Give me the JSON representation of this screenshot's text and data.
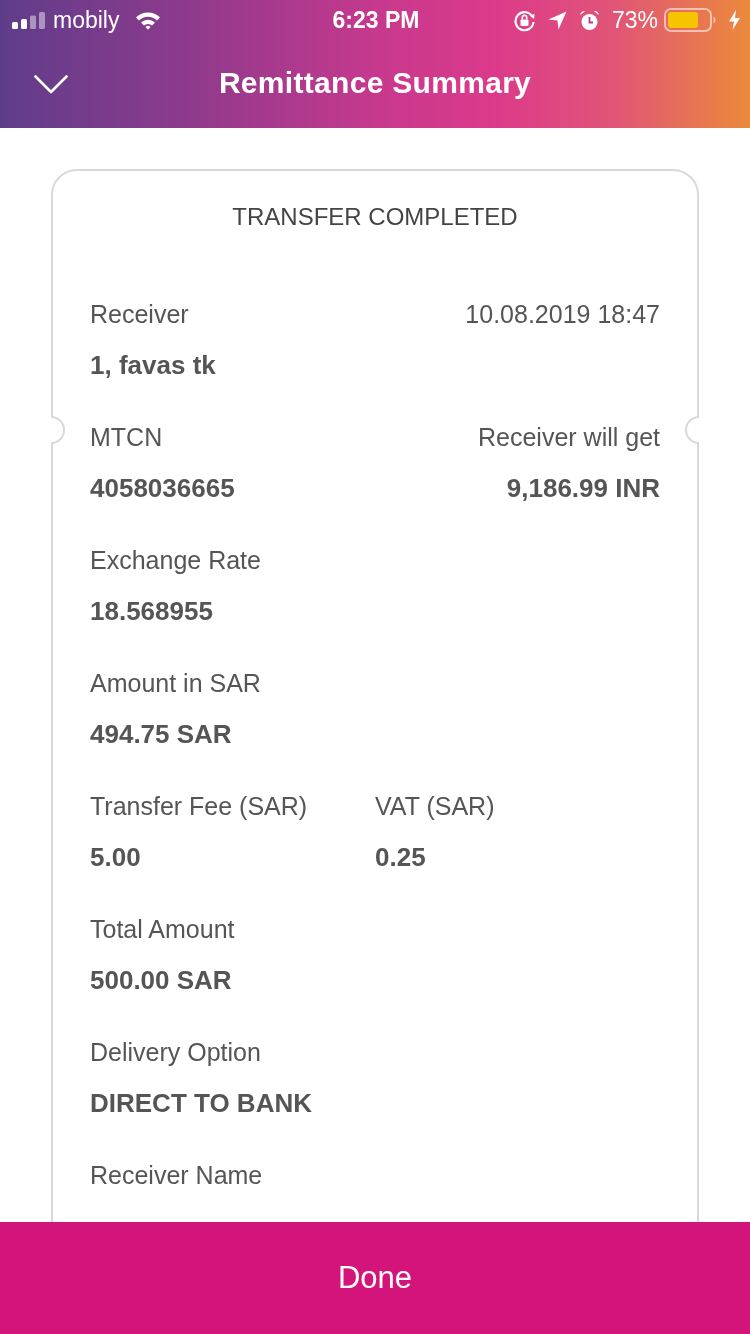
{
  "status_bar": {
    "carrier": "mobily",
    "time": "6:23 PM",
    "battery": "73%"
  },
  "header": {
    "title": "Remittance Summary"
  },
  "receipt": {
    "title": "TRANSFER COMPLETED",
    "rows": [
      {
        "kind": "split",
        "fields": [
          {
            "label": "Receiver",
            "value": "1, favas tk"
          },
          {
            "date": "10.08.2019 18:47"
          }
        ]
      },
      {
        "kind": "split",
        "fields": [
          {
            "label": "MTCN",
            "value": "4058036665"
          },
          {
            "label": "Receiver will get",
            "value": "9,186.99 INR"
          }
        ]
      },
      {
        "kind": "columns",
        "fields": [
          {
            "label": "Exchange Rate",
            "value": "18.568955"
          }
        ]
      },
      {
        "kind": "columns",
        "fields": [
          {
            "label": "Amount in SAR",
            "value": "494.75 SAR"
          }
        ]
      },
      {
        "kind": "columns",
        "fields": [
          {
            "label": "Transfer Fee (SAR)",
            "value": "5.00"
          },
          {
            "label": "VAT (SAR)",
            "value": "0.25"
          }
        ]
      },
      {
        "kind": "columns",
        "fields": [
          {
            "label": "Total Amount",
            "value": "500.00 SAR"
          }
        ]
      },
      {
        "kind": "columns",
        "fields": [
          {
            "label": "Delivery Option",
            "value": "DIRECT TO BANK"
          }
        ]
      },
      {
        "kind": "columns",
        "fields": [
          {
            "label": "Receiver Name"
          }
        ]
      }
    ]
  },
  "done_button": {
    "label": "Done"
  }
}
